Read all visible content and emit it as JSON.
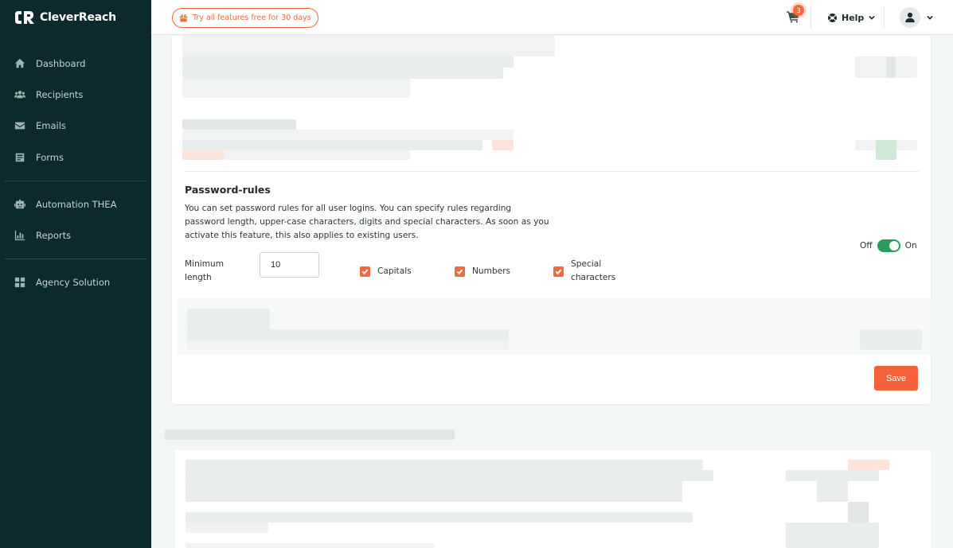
{
  "app": {
    "brand": "CleverReach"
  },
  "sidebar": {
    "items": [
      {
        "label": "Dashboard",
        "icon": "home-icon"
      },
      {
        "label": "Recipients",
        "icon": "users-icon"
      },
      {
        "label": "Emails",
        "icon": "envelope-icon"
      },
      {
        "label": "Forms",
        "icon": "form-icon"
      },
      {
        "label": "Automation THEA",
        "icon": "robot-icon"
      },
      {
        "label": "Reports",
        "icon": "chart-icon"
      },
      {
        "label": "Agency Solution",
        "icon": "grid-icon"
      }
    ]
  },
  "topbar": {
    "trial_label": "Try all features free for 30 days",
    "cart_count": "3",
    "help_label": "Help"
  },
  "password_rules": {
    "title": "Password-rules",
    "description": "You can set password rules for all user logins. You can specify rules regarding password length, upper-case characters, digits and special characters. As soon as you activate this feature, this also applies to existing users.",
    "min_length_label": "Minimum length",
    "min_length_value": "10",
    "capitals_label": "Capitals",
    "numbers_label": "Numbers",
    "special_label": "Special characters",
    "toggle_off_label": "Off",
    "toggle_on_label": "On"
  },
  "actions": {
    "save_label": "Save"
  },
  "colors": {
    "accent": "#f4613a",
    "sidebar_bg": "#0c2a2e",
    "toggle_on": "#2a9d5a"
  }
}
